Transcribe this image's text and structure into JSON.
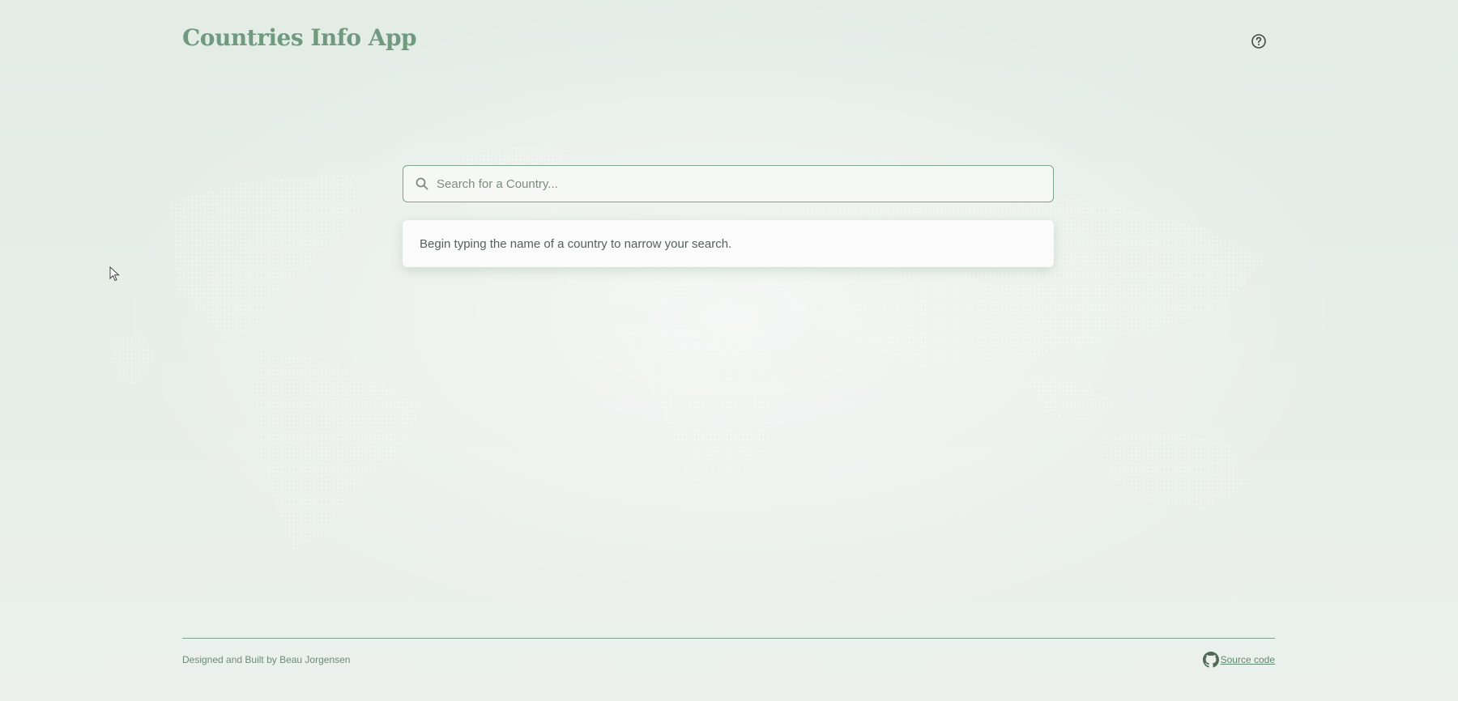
{
  "app": {
    "title": "Countries Info App"
  },
  "header": {
    "help_icon": "question-circle-icon"
  },
  "search": {
    "placeholder": "Search for a Country...",
    "value": "",
    "icon": "search-icon"
  },
  "hint": {
    "text": "Begin typing the name of a country to narrow your search."
  },
  "footer": {
    "credit": "Designed and Built by Beau Jorgensen",
    "source_label": "Source code",
    "source_icon": "github-icon"
  },
  "colors": {
    "accent": "#6f9a7e",
    "background": "#e9efea",
    "border": "#7ea58c"
  }
}
